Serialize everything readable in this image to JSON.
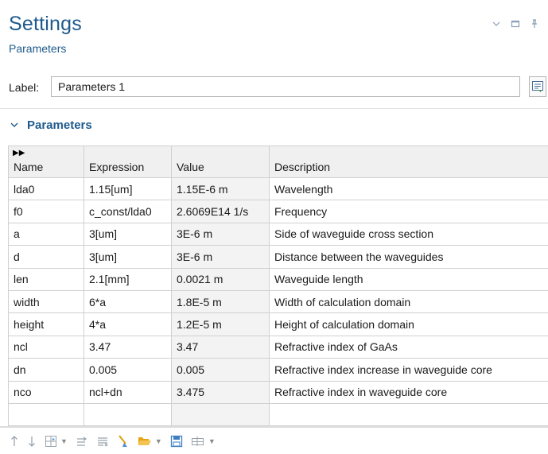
{
  "header": {
    "title": "Settings",
    "subtitle": "Parameters",
    "window_controls": [
      "chevron-down-icon",
      "maximize-icon",
      "pin-icon"
    ]
  },
  "label_row": {
    "label": "Label:",
    "value": "Parameters 1"
  },
  "section": {
    "title": "Parameters",
    "expanded": true
  },
  "table": {
    "columns": [
      "Name",
      "Expression",
      "Value",
      "Description"
    ],
    "rows": [
      {
        "name": "lda0",
        "expression": "1.15[um]",
        "value": "1.15E-6 m",
        "description": "Wavelength"
      },
      {
        "name": "f0",
        "expression": "c_const/lda0",
        "value": "2.6069E14 1/s",
        "description": "Frequency"
      },
      {
        "name": "a",
        "expression": "3[um]",
        "value": "3E-6 m",
        "description": "Side of waveguide cross section"
      },
      {
        "name": "d",
        "expression": "3[um]",
        "value": "3E-6 m",
        "description": "Distance between the waveguides"
      },
      {
        "name": "len",
        "expression": "2.1[mm]",
        "value": "0.0021 m",
        "description": "Waveguide length"
      },
      {
        "name": "width",
        "expression": "6*a",
        "value": "1.8E-5 m",
        "description": "Width of calculation domain"
      },
      {
        "name": "height",
        "expression": "4*a",
        "value": "1.2E-5 m",
        "description": "Height of calculation domain"
      },
      {
        "name": "ncl",
        "expression": "3.47",
        "value": "3.47",
        "description": "Refractive index of GaAs"
      },
      {
        "name": "dn",
        "expression": "0.005",
        "value": "0.005",
        "description": "Refractive index increase in waveguide core"
      },
      {
        "name": "nco",
        "expression": "ncl+dn",
        "value": "3.475",
        "description": "Refractive index in waveguide core"
      },
      {
        "name": "",
        "expression": "",
        "value": "",
        "description": ""
      }
    ]
  },
  "toolbar": {
    "icons": [
      "move-up-icon",
      "move-down-icon",
      "insert-row-icon",
      "sort-icon",
      "delete-rows-icon",
      "clear-icon",
      "open-folder-icon",
      "save-icon",
      "table-options-icon"
    ]
  },
  "colors": {
    "accent": "#1e5a8c",
    "value_cell_bg": "#f3f3f3",
    "header_bg": "#f0f0f0",
    "folder": "#e8a317"
  }
}
